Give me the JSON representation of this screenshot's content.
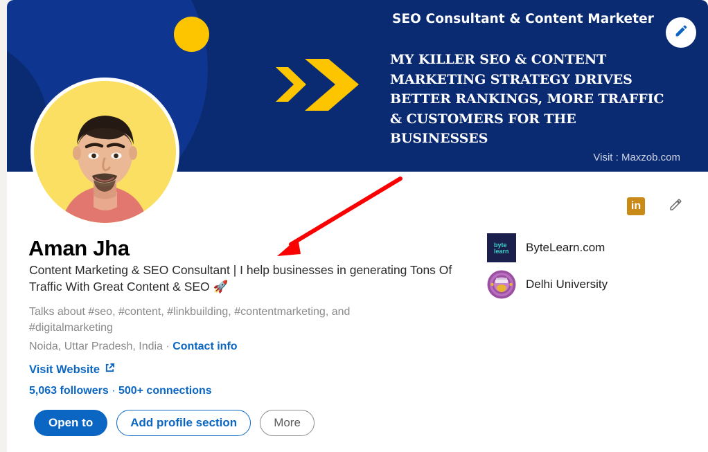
{
  "banner": {
    "title": "SEO Consultant & Content Marketer",
    "tagline": "MY KILLER SEO & CONTENT MARKETING STRATEGY DRIVES BETTER RANKINGS, MORE TRAFFIC & CUSTOMERS FOR THE BUSINESSES",
    "visit": "Visit : Maxzob.com",
    "edit_icon": "pencil-icon",
    "dot_icon": "yellow-circle-decoration",
    "chevron_icon": "double-chevron-right-decoration",
    "bg_color": "#0a2a72",
    "accent_color": "#fdc500"
  },
  "profile": {
    "avatar_icon": "profile-photo",
    "name": "Aman Jha",
    "headline": "Content Marketing & SEO Consultant | I help businesses in generating Tons Of Traffic With Great Content & SEO ",
    "headline_emoji": "🚀",
    "talks_about": "Talks about #seo, #content, #linkbuilding, #contentmarketing, and #digitalmarketing",
    "location": "Noida, Uttar Pradesh, India",
    "location_separator": " · ",
    "contact_info": "Contact info",
    "website_label": "Visit Website",
    "website_icon": "external-link-icon",
    "followers": "5,063 followers",
    "connections_separator": " · ",
    "connections": "500+ connections"
  },
  "actions": [
    {
      "label": "Open to",
      "style": "primary"
    },
    {
      "label": "Add profile section",
      "style": "outline-blue"
    },
    {
      "label": "More",
      "style": "outline-gray"
    }
  ],
  "header_icons": {
    "linkedin_badge": "in",
    "linkedin_badge_color": "#ca8a17",
    "edit_pencil": "pencil-icon"
  },
  "organizations": [
    {
      "name": "ByteLearn.com",
      "logo_icon": "bytelearn-logo",
      "logo_line1": "byte",
      "logo_line2": "learn"
    },
    {
      "name": "Delhi University",
      "logo_icon": "delhi-university-seal"
    }
  ],
  "annotation": {
    "arrow_icon": "red-arrow-annotation",
    "color": "#fa0000"
  }
}
